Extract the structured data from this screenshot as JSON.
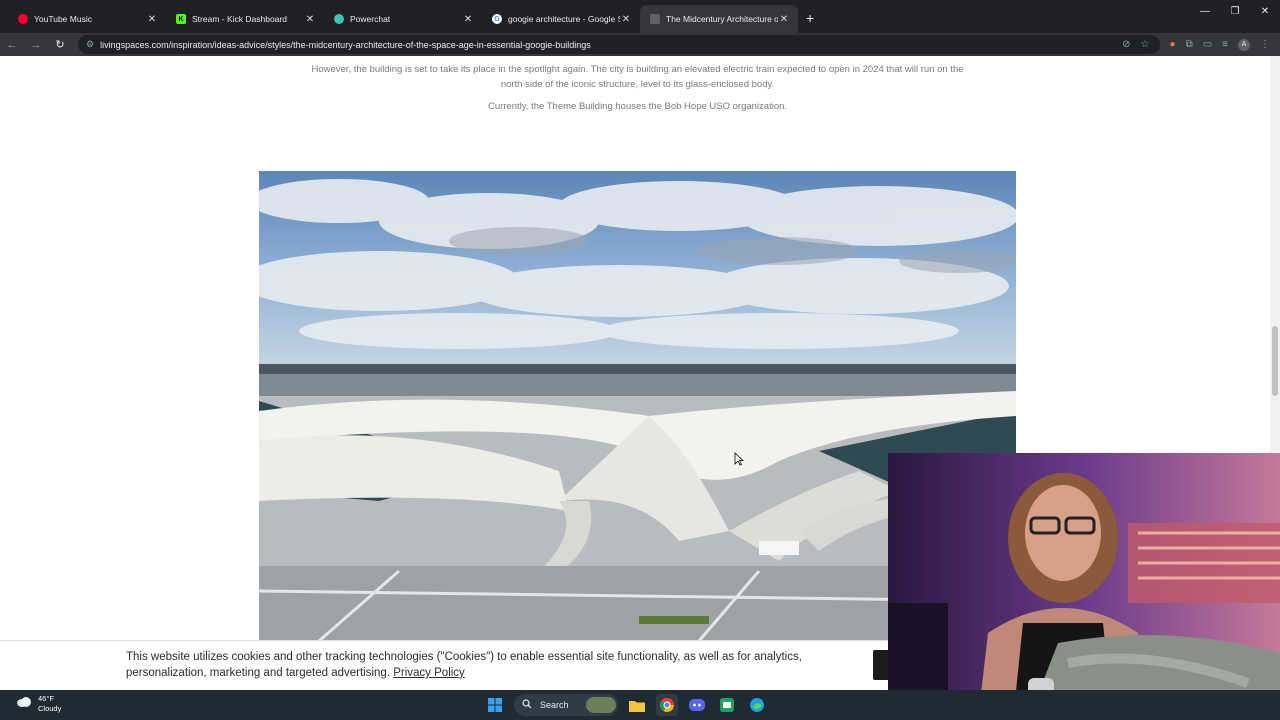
{
  "browser": {
    "tabs": [
      {
        "title": "YouTube Music",
        "icon": "youtube-music-icon",
        "color": "#ff0033",
        "active": false
      },
      {
        "title": "Stream - Kick Dashboard",
        "icon": "kick-icon",
        "color": "#53fc18",
        "active": false
      },
      {
        "title": "Powerchat",
        "icon": "powerchat-icon",
        "color": "#3ac6b8",
        "active": false
      },
      {
        "title": "googie architecture - Google S",
        "icon": "google-icon",
        "color": "#ffffff",
        "active": false
      },
      {
        "title": "The Midcentury Architecture of",
        "icon": "page-icon",
        "color": "#5f6368",
        "active": true
      }
    ],
    "url": "livingspaces.com/inspiration/ideas-advice/styles/the-midcentury-architecture-of-the-space-age-in-essential-googie-buildings",
    "profile_initial": "A"
  },
  "article": {
    "para1_line1": "However, the building is set to take its place in the spotlight again. The city is building an elevated electric train expected to open in 2024 that will run on the",
    "para1_line2": "north side of the iconic structure, level to its glass-enclosed body.",
    "para2": "Currently, the Theme Building houses the Bob Hope USO organization."
  },
  "cookie_banner": {
    "text_line1": "This website utilizes cookies and other tracking technologies (\"Cookies\") to enable essential site functionality, as well as for analytics,",
    "text_line2": "personalization, marketing and targeted advertising.",
    "link": "Privacy Policy"
  },
  "taskbar": {
    "temperature": "46°F",
    "condition": "Cloudy",
    "search_label": "Search"
  },
  "colors": {
    "chrome_dark": "#202124",
    "chrome_active": "#35363a",
    "body_text": "#7a7a7a",
    "taskbar": "#1f2a33"
  }
}
